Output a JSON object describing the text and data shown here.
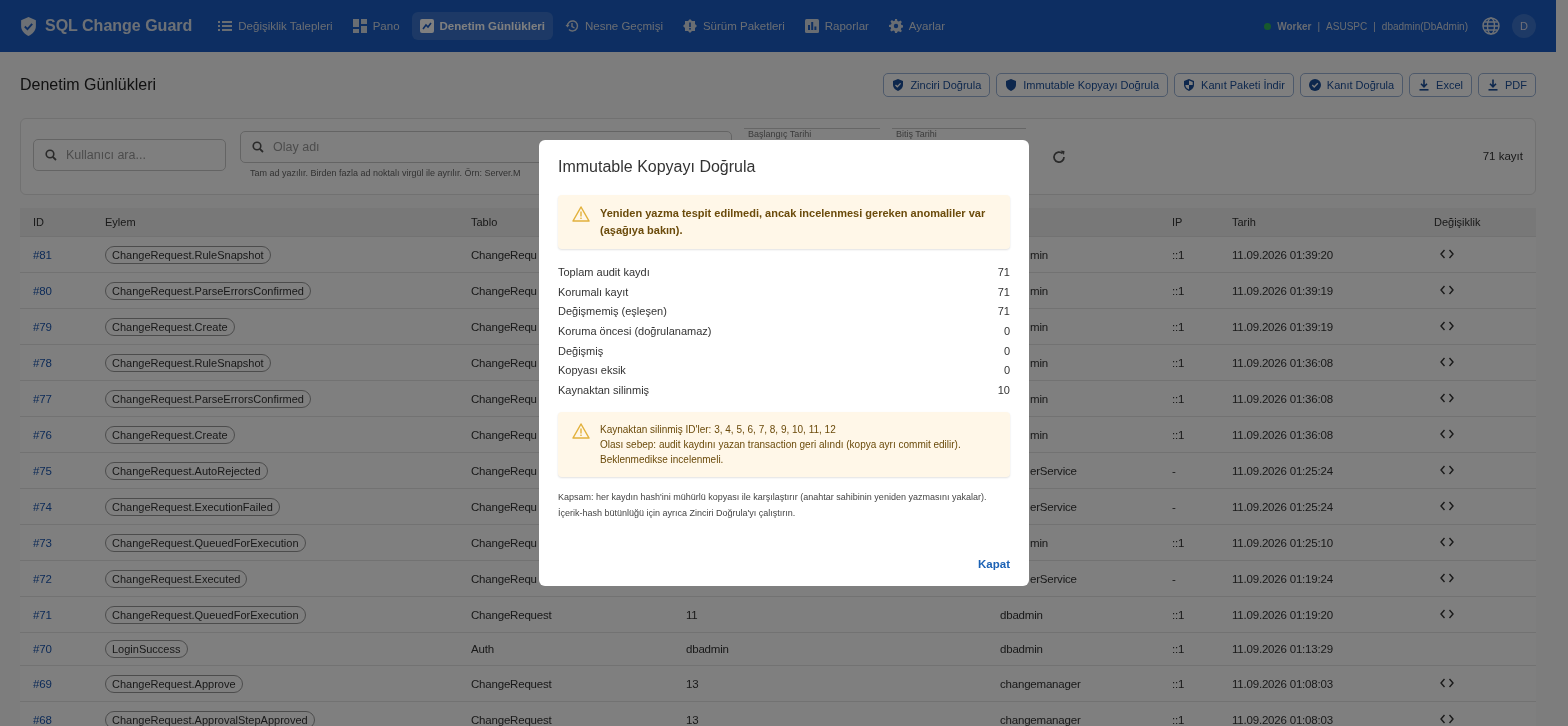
{
  "navbar": {
    "brand": "SQL Change Guard",
    "items": [
      {
        "label": "Değişiklik Talepleri",
        "selected": false
      },
      {
        "label": "Pano",
        "selected": false
      },
      {
        "label": "Denetim Günlükleri",
        "selected": true
      },
      {
        "label": "Nesne Geçmişi",
        "selected": false
      },
      {
        "label": "Sürüm Paketleri",
        "selected": false
      },
      {
        "label": "Raporlar",
        "selected": false
      },
      {
        "label": "Ayarlar",
        "selected": false
      }
    ],
    "status": {
      "worker": "Worker",
      "separator_1": "|",
      "host": "ASUSPC",
      "separator_2": "|",
      "user": "dbadmin(DbAdmin)"
    },
    "avatar": "D"
  },
  "page": {
    "title": "Denetim Günlükleri",
    "actions": [
      {
        "label": "Zinciri Doğrula"
      },
      {
        "label": "Immutable Kopyayı Doğrula"
      },
      {
        "label": "Kanıt Paketi İndir"
      },
      {
        "label": "Kanıt Doğrula"
      },
      {
        "label": "Excel"
      },
      {
        "label": "PDF"
      }
    ]
  },
  "filters": {
    "user_search": {
      "placeholder": "Kullanıcı ara..."
    },
    "event_search": {
      "placeholder": "Olay adı",
      "hint": "Tam ad yazılır. Birden fazla ad noktalı virgül ile ayrılır. Örn: Server.M"
    },
    "start_date": {
      "label": "Başlangıç Tarihi"
    },
    "end_date": {
      "label": "Bitiş Tarihi"
    },
    "count": "71 kayıt"
  },
  "table": {
    "columns": [
      "ID",
      "Eylem",
      "Tablo",
      "",
      "",
      "IP",
      "Tarih",
      "Değişiklik"
    ],
    "rows": [
      {
        "id": "#81",
        "action": "ChangeRequest.RuleSnapshot",
        "table": "ChangeRequ",
        "user": "min",
        "user_cut": true,
        "ip": "::1",
        "date": "11.09.2026 01:39:20",
        "has_diff": true
      },
      {
        "id": "#80",
        "action": "ChangeRequest.ParseErrorsConfirmed",
        "table": "ChangeRequ",
        "user": "min",
        "user_cut": true,
        "ip": "::1",
        "date": "11.09.2026 01:39:19",
        "has_diff": true
      },
      {
        "id": "#79",
        "action": "ChangeRequest.Create",
        "table": "ChangeRequ",
        "user": "min",
        "user_cut": true,
        "ip": "::1",
        "date": "11.09.2026 01:39:19",
        "has_diff": true
      },
      {
        "id": "#78",
        "action": "ChangeRequest.RuleSnapshot",
        "table": "ChangeRequ",
        "user": "min",
        "user_cut": true,
        "ip": "::1",
        "date": "11.09.2026 01:36:08",
        "has_diff": true
      },
      {
        "id": "#77",
        "action": "ChangeRequest.ParseErrorsConfirmed",
        "table": "ChangeRequ",
        "user": "min",
        "user_cut": true,
        "ip": "::1",
        "date": "11.09.2026 01:36:08",
        "has_diff": true
      },
      {
        "id": "#76",
        "action": "ChangeRequest.Create",
        "table": "ChangeRequ",
        "user": "min",
        "user_cut": true,
        "ip": "::1",
        "date": "11.09.2026 01:36:08",
        "has_diff": true
      },
      {
        "id": "#75",
        "action": "ChangeRequest.AutoRejected",
        "table": "ChangeRequ",
        "user": "erService",
        "user_cut": true,
        "ip": "-",
        "date": "11.09.2026 01:25:24",
        "has_diff": true
      },
      {
        "id": "#74",
        "action": "ChangeRequest.ExecutionFailed",
        "table": "ChangeRequ",
        "user": "erService",
        "user_cut": true,
        "ip": "-",
        "date": "11.09.2026 01:25:24",
        "has_diff": true
      },
      {
        "id": "#73",
        "action": "ChangeRequest.QueuedForExecution",
        "table": "ChangeRequ",
        "user": "min",
        "user_cut": true,
        "ip": "::1",
        "date": "11.09.2026 01:25:10",
        "has_diff": true
      },
      {
        "id": "#72",
        "action": "ChangeRequest.Executed",
        "table": "ChangeRequ",
        "user": "erService",
        "user_cut": true,
        "ip": "-",
        "date": "11.09.2026 01:19:24",
        "has_diff": true
      },
      {
        "id": "#71",
        "action": "ChangeRequest.QueuedForExecution",
        "table": "ChangeRequest",
        "record": "11",
        "user": "dbadmin",
        "user_cut": false,
        "ip": "::1",
        "date": "11.09.2026 01:19:20",
        "has_diff": true
      },
      {
        "id": "#70",
        "action": "LoginSuccess",
        "table": "Auth",
        "record": "dbadmin",
        "user": "dbadmin",
        "user_cut": false,
        "ip": "::1",
        "date": "11.09.2026 01:13:29",
        "has_diff": false
      },
      {
        "id": "#69",
        "action": "ChangeRequest.Approve",
        "table": "ChangeRequest",
        "record": "13",
        "user": "changemanager",
        "user_cut": false,
        "ip": "::1",
        "date": "11.09.2026 01:08:03",
        "has_diff": true
      },
      {
        "id": "#68",
        "action": "ChangeRequest.ApprovalStepApproved",
        "table": "ChangeRequest",
        "record": "13",
        "user": "changemanager",
        "user_cut": false,
        "ip": "::1",
        "date": "11.09.2026 01:08:03",
        "has_diff": true
      }
    ]
  },
  "dialog": {
    "title": "Immutable Kopyayı Doğrula",
    "alert": {
      "kind": "warning",
      "text": "Yeniden yazma tespit edilmedi, ancak incelenmesi gereken anomaliler var (aşağıya bakın)."
    },
    "stats": [
      {
        "label": "Toplam audit kaydı",
        "value": "71"
      },
      {
        "label": "Korumalı kayıt",
        "value": "71"
      },
      {
        "label": "Değişmemiş (eşleşen)",
        "value": "71"
      },
      {
        "label": "Koruma öncesi (doğrulanamaz)",
        "value": "0"
      },
      {
        "label": "Değişmiş",
        "value": "0"
      },
      {
        "label": "Kopyası eksik",
        "value": "0"
      },
      {
        "label": "Kaynaktan silinmiş",
        "value": "10"
      }
    ],
    "notice": {
      "kind": "warning",
      "lines": [
        "Kaynaktan silinmiş ID'ler: 3, 4, 5, 6, 7, 8, 9, 10, 11, 12",
        "Olası sebep: audit kaydını yazan transaction geri alındı (kopya ayrı commit edilir).",
        "Beklenmedikse incelenmeli."
      ]
    },
    "footnote": "Kapsam: her kaydın hash'ini mühürlü kopyası ile karşılaştırır (anahtar sahibinin yeniden yazmasını yakalar). İçerik-hash bütünlüğü için ayrıca Zinciri Doğrula'yı çalıştırın.",
    "close": "Kapat"
  }
}
